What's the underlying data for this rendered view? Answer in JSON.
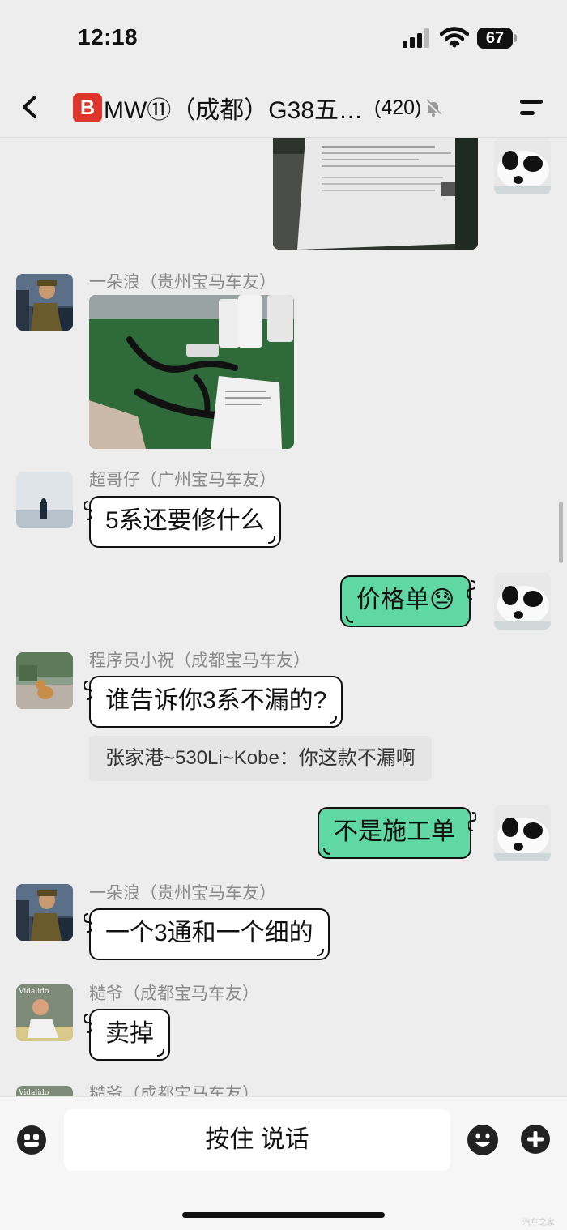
{
  "status": {
    "time": "12:18",
    "battery": "67"
  },
  "header": {
    "badge": "B",
    "title": "MW⑪（成都）G38五…",
    "member_count": "(420)"
  },
  "messages": [
    {
      "sender": "一朵浪（贵州宝马车友）"
    },
    {
      "sender": "超哥仔（广州宝马车友）",
      "text": "5系还要修什么"
    },
    {
      "text": "价格单😓"
    },
    {
      "sender": "程序员小祝（成都宝马车友）",
      "text": "谁告诉你3系不漏的?",
      "quote": "张家港~530Li~Kobe：你这款不漏啊"
    },
    {
      "text": "不是施工单"
    },
    {
      "sender": "一朵浪（贵州宝马车友）",
      "text": "一个3通和一个细的"
    },
    {
      "sender": "糙爷（成都宝马车友）",
      "text": "卖掉",
      "avatar_text": "Vidalido"
    },
    {
      "sender": "糙爷（成都宝马车友）",
      "avatar_text": "Vidalido"
    }
  ],
  "input": {
    "hold_to_talk": "按住 说话"
  },
  "watermark": "汽车之家",
  "colors": {
    "my_bubble": "#5fd8a4",
    "background": "#ededed",
    "badge_red": "#e0352b"
  },
  "icons": [
    "back-arrow-icon",
    "mute-bell-icon",
    "menu-icon",
    "voice-icon",
    "emoji-icon",
    "plus-icon"
  ]
}
